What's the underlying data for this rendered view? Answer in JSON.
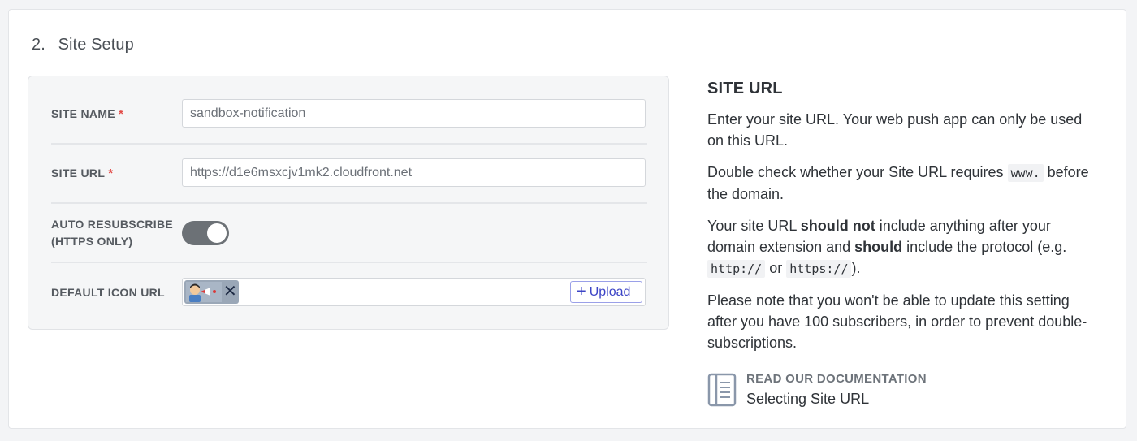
{
  "section": {
    "number": "2.",
    "title": "Site Setup"
  },
  "form": {
    "site_name": {
      "label": "SITE NAME",
      "required_mark": "*",
      "value": "sandbox-notification"
    },
    "site_url": {
      "label": "SITE URL",
      "required_mark": "*",
      "value": "https://d1e6msxcjv1mk2.cloudfront.net"
    },
    "auto_resubscribe": {
      "label_line1": "AUTO RESUBSCRIBE",
      "label_line2": "(HTTPS ONLY)",
      "enabled": true
    },
    "default_icon": {
      "label": "DEFAULT ICON URL",
      "remove_glyph": "✕",
      "upload_label": "Upload",
      "upload_glyph": "+"
    }
  },
  "help": {
    "title": "SITE URL",
    "p1": "Enter your site URL. Your web push app can only be used on this URL.",
    "p2_pre": "Double check whether your Site URL requires ",
    "p2_code": "www.",
    "p2_post": " before the domain.",
    "p3_a": "Your site URL ",
    "p3_b": "should not",
    "p3_c": " include anything after your domain extension and ",
    "p3_d": "should",
    "p3_e": " include the protocol (e.g. ",
    "p3_code1": "http://",
    "p3_or": " or ",
    "p3_code2": "https://",
    "p3_end": ").",
    "p4": "Please note that you won't be able to update this setting after you have 100 subscribers, in order to prevent double-subscriptions."
  },
  "doc_link": {
    "kicker": "READ OUR DOCUMENTATION",
    "title": "Selecting Site URL",
    "icon": "document-icon"
  },
  "colors": {
    "required": "#e24b47",
    "toggle_on": "#6c7176",
    "accent": "#3d45c6"
  }
}
